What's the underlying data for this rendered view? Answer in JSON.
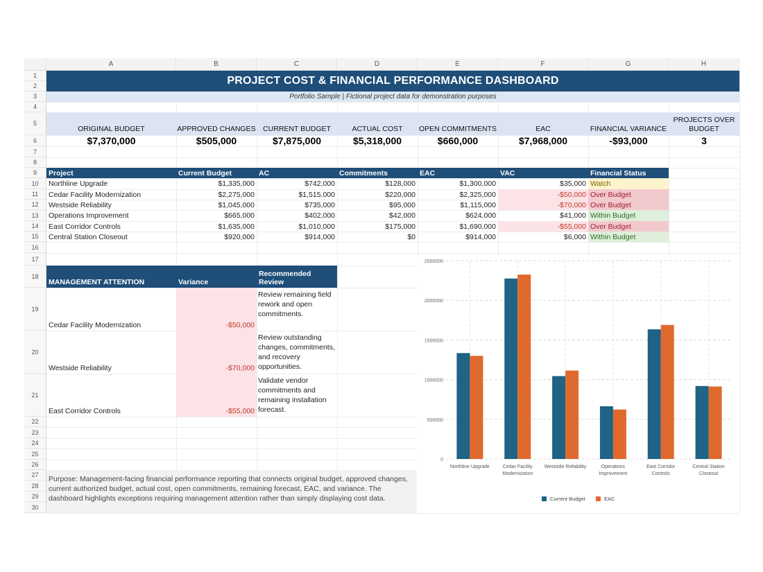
{
  "columns": [
    "A",
    "B",
    "C",
    "D",
    "E",
    "F",
    "G",
    "H"
  ],
  "rows": [
    "1",
    "2",
    "3",
    "4",
    "5",
    "6",
    "7",
    "8",
    "9",
    "10",
    "11",
    "12",
    "13",
    "14",
    "15",
    "16",
    "17",
    "18",
    "19",
    "20",
    "21",
    "22",
    "23",
    "24",
    "25",
    "26",
    "27",
    "28",
    "29",
    "30"
  ],
  "title": "PROJECT COST & FINANCIAL PERFORMANCE DASHBOARD",
  "subtitle": "Portfolio Sample | Fictional project data for demonstration purposes",
  "kpis": [
    {
      "label": "ORIGINAL BUDGET",
      "value": "$7,370,000"
    },
    {
      "label": "APPROVED CHANGES",
      "value": "$505,000"
    },
    {
      "label": "CURRENT BUDGET",
      "value": "$7,875,000"
    },
    {
      "label": "ACTUAL COST",
      "value": "$5,318,000"
    },
    {
      "label": "OPEN COMMITMENTS",
      "value": "$660,000"
    },
    {
      "label": "EAC",
      "value": "$7,968,000"
    },
    {
      "label": "FINANCIAL VARIANCE",
      "value": "-$93,000"
    },
    {
      "label": "PROJECTS OVER BUDGET",
      "value": "3"
    }
  ],
  "project_table": {
    "headers": [
      "Project",
      "Current Budget",
      "AC",
      "Commitments",
      "EAC",
      "VAC",
      "Financial Status"
    ],
    "rows": [
      {
        "project": "Northline Upgrade",
        "budget": "$1,335,000",
        "ac": "$742,000",
        "commit": "$128,000",
        "eac": "$1,300,000",
        "vac": "$35,000",
        "status": "Watch",
        "status_type": "watch"
      },
      {
        "project": "Cedar Facility Modernization",
        "budget": "$2,275,000",
        "ac": "$1,515,000",
        "commit": "$220,000",
        "eac": "$2,325,000",
        "vac": "-$50,000",
        "status": "Over Budget",
        "status_type": "over"
      },
      {
        "project": "Westside Reliability",
        "budget": "$1,045,000",
        "ac": "$735,000",
        "commit": "$95,000",
        "eac": "$1,115,000",
        "vac": "-$70,000",
        "status": "Over Budget",
        "status_type": "over"
      },
      {
        "project": "Operations Improvement",
        "budget": "$665,000",
        "ac": "$402,000",
        "commit": "$42,000",
        "eac": "$624,000",
        "vac": "$41,000",
        "status": "Within Budget",
        "status_type": "within"
      },
      {
        "project": "East Corridor Controls",
        "budget": "$1,635,000",
        "ac": "$1,010,000",
        "commit": "$175,000",
        "eac": "$1,690,000",
        "vac": "-$55,000",
        "status": "Over Budget",
        "status_type": "over"
      },
      {
        "project": "Central Station Closeout",
        "budget": "$920,000",
        "ac": "$914,000",
        "commit": "$0",
        "eac": "$914,000",
        "vac": "$6,000",
        "status": "Within Budget",
        "status_type": "within"
      }
    ]
  },
  "attention_table": {
    "headers": [
      "MANAGEMENT ATTENTION",
      "Variance",
      "Recommended Review"
    ],
    "rows": [
      {
        "project": "Cedar Facility Modernization",
        "variance": "-$50,000",
        "review": "Review remaining field rework and open commitments."
      },
      {
        "project": "Westside Reliability",
        "variance": "-$70,000",
        "review": "Review outstanding changes, commitments, and recovery opportunities."
      },
      {
        "project": "East Corridor Controls",
        "variance": "-$55,000",
        "review": "Validate vendor commitments and remaining installation forecast."
      }
    ]
  },
  "purpose": "Purpose: Management-facing financial performance reporting that connects original budget, approved changes, current authorized budget, actual cost, open commitments, remaining forecast, EAC, and variance. The dashboard highlights exceptions requiring management attention rather than simply displaying cost data.",
  "colors": {
    "header": "#1f4e79",
    "series_budget": "#1f6385",
    "series_eac": "#e06a2e"
  },
  "chart_data": {
    "type": "bar",
    "categories": [
      "Northline Upgrade",
      "Cedar Facility Modernization",
      "Westside Reliability",
      "Operations Improvement",
      "East Corridor Controls",
      "Central Station Closeout"
    ],
    "category_labels": [
      [
        "Northline Upgrade"
      ],
      [
        "Cedar Facility",
        "Modernization"
      ],
      [
        "Westside Reliability"
      ],
      [
        "Operations",
        "Improvement"
      ],
      [
        "East Corridor",
        "Controls"
      ],
      [
        "Central Station",
        "Closeout"
      ]
    ],
    "series": [
      {
        "name": "Current Budget",
        "values": [
          1335000,
          2275000,
          1045000,
          665000,
          1635000,
          920000
        ]
      },
      {
        "name": "EAC",
        "values": [
          1300000,
          2325000,
          1115000,
          624000,
          1690000,
          914000
        ]
      }
    ],
    "y_ticks": [
      "0",
      "500000",
      "1000000",
      "1500000",
      "2000000",
      "2500000"
    ],
    "ylim": [
      0,
      2500000
    ],
    "legend": "bottom",
    "grid": true
  }
}
